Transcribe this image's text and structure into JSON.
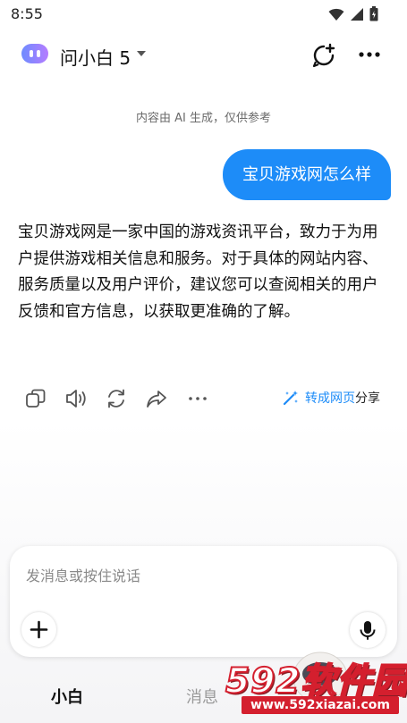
{
  "status_bar": {
    "time": "8:55"
  },
  "header": {
    "title": "问小白 5"
  },
  "chat": {
    "disclaimer": "内容由 AI 生成，仅供参考",
    "user_message": "宝贝游戏网怎么样",
    "assistant_message": "宝贝游戏网是一家中国的游戏资讯平台，致力于为用户提供游戏相关信息和服务。对于具体的网站内容、服务质量以及用户评价，建议您可以查阅相关的用户反馈和官方信息，以获取更准确的了解。",
    "actions": {
      "to_web_blue": "转成网页",
      "to_web_dark": "分享"
    }
  },
  "composer": {
    "placeholder": "发消息或按住说话"
  },
  "bottom_nav": {
    "home": "小白",
    "messages": "消息"
  },
  "watermark": {
    "brand": "592软件园",
    "url": "www.592xiazai.com"
  },
  "icons": [
    "wifi-icon",
    "signal-icon",
    "battery-icon",
    "logo-icon",
    "caret-down-icon",
    "new-chat-icon",
    "more-icon",
    "copy-icon",
    "speaker-icon",
    "refresh-icon",
    "share-icon",
    "ellipsis-icon",
    "magic-wand-icon",
    "plus-icon",
    "mic-icon"
  ],
  "colors": {
    "accent": "#1d8cf8",
    "watermark_red": "#d41f2e"
  }
}
